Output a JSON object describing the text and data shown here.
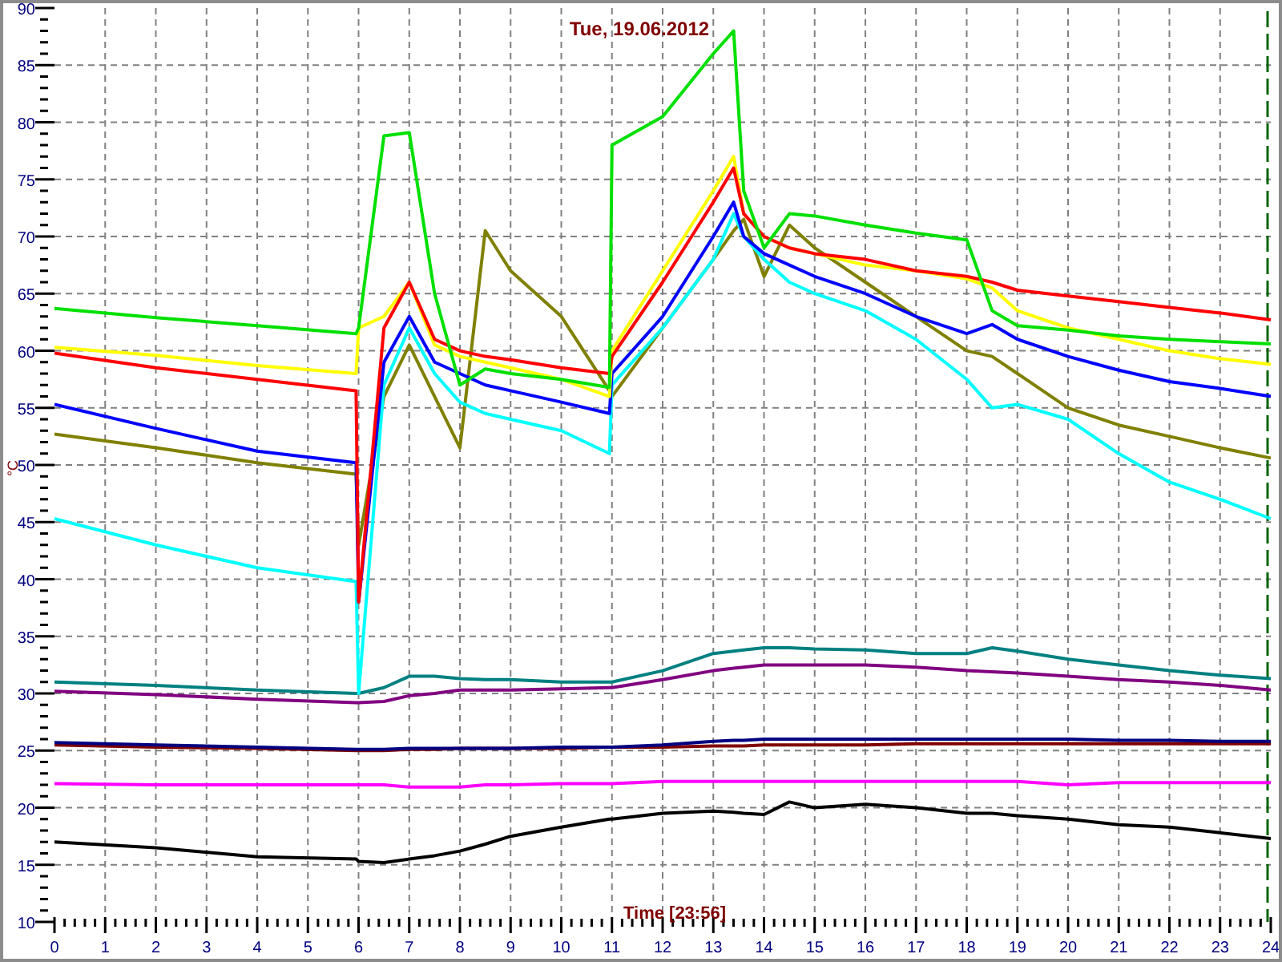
{
  "chart": {
    "chart_data": {
      "type": "line",
      "title": "Tue, 19.06.2012",
      "xlabel": "Time [23:56]",
      "ylabel": "°C",
      "x": [
        0,
        2,
        4,
        5.95,
        6,
        6.5,
        7,
        7.5,
        8,
        8.5,
        9,
        10,
        10.95,
        11,
        12,
        13,
        13.4,
        13.6,
        14,
        14.5,
        15,
        16,
        17,
        18,
        18.5,
        19,
        20,
        21,
        22,
        23,
        24
      ],
      "xlim": [
        0,
        24
      ],
      "ylim": [
        10,
        90
      ],
      "xticks": [
        0,
        1,
        2,
        3,
        4,
        5,
        6,
        7,
        8,
        9,
        10,
        11,
        12,
        13,
        14,
        15,
        16,
        17,
        18,
        19,
        20,
        21,
        22,
        23,
        24
      ],
      "yticks": [
        10,
        15,
        20,
        25,
        30,
        35,
        40,
        45,
        50,
        55,
        60,
        65,
        70,
        75,
        80,
        85,
        90
      ],
      "series": [
        {
          "color": "#800000",
          "values": [
            25.5,
            25.3,
            25.2,
            25,
            25,
            25,
            25.1,
            25.1,
            25.2,
            25.2,
            25.2,
            25.2,
            25.3,
            25.3,
            25.3,
            25.4,
            25.4,
            25.4,
            25.5,
            25.5,
            25.5,
            25.5,
            25.6,
            25.6,
            25.6,
            25.6,
            25.6,
            25.6,
            25.6,
            25.6,
            25.6
          ]
        },
        {
          "color": "#000080",
          "values": [
            25.7,
            25.5,
            25.3,
            25.1,
            25.1,
            25.1,
            25.2,
            25.2,
            25.2,
            25.2,
            25.2,
            25.3,
            25.3,
            25.3,
            25.5,
            25.8,
            25.9,
            25.9,
            26,
            26,
            26,
            26,
            26,
            26,
            26,
            26,
            26,
            25.9,
            25.9,
            25.8,
            25.8
          ]
        },
        {
          "color": "#ff00ff",
          "values": [
            22.1,
            22,
            22,
            22,
            22,
            22,
            21.8,
            21.8,
            21.8,
            22,
            22,
            22.1,
            22.1,
            22.1,
            22.3,
            22.3,
            22.3,
            22.3,
            22.3,
            22.3,
            22.3,
            22.3,
            22.3,
            22.3,
            22.3,
            22.3,
            22,
            22.2,
            22.2,
            22.2,
            22.2
          ]
        },
        {
          "color": "#000000",
          "values": [
            17,
            16.5,
            15.7,
            15.5,
            15.3,
            15.2,
            15.5,
            15.8,
            16.2,
            16.8,
            17.5,
            18.3,
            19,
            19,
            19.5,
            19.7,
            19.6,
            19.5,
            19.4,
            20.5,
            20,
            20.3,
            20,
            19.5,
            19.5,
            19.3,
            19,
            18.5,
            18.3,
            17.8,
            17.3
          ]
        },
        {
          "color": "#800080",
          "values": [
            30.2,
            29.9,
            29.5,
            29.2,
            29.2,
            29.3,
            29.8,
            30,
            30.3,
            30.3,
            30.3,
            30.4,
            30.5,
            30.5,
            31.2,
            32,
            32.2,
            32.3,
            32.5,
            32.5,
            32.5,
            32.5,
            32.3,
            32,
            31.9,
            31.8,
            31.5,
            31.2,
            31,
            30.7,
            30.3
          ]
        },
        {
          "color": "#008080",
          "values": [
            31,
            30.7,
            30.3,
            30,
            30,
            30.5,
            31.5,
            31.5,
            31.3,
            31.2,
            31.2,
            31,
            31,
            31,
            32,
            33.5,
            33.7,
            33.8,
            34,
            34,
            33.9,
            33.8,
            33.5,
            33.5,
            34,
            33.7,
            33,
            32.5,
            32,
            31.6,
            31.3
          ]
        },
        {
          "color": "#808000",
          "values": [
            52.7,
            51.5,
            50.2,
            49.2,
            43,
            56,
            60.5,
            56,
            51.5,
            70.5,
            67,
            63,
            56.5,
            56,
            62,
            68,
            70.5,
            71.5,
            66.5,
            71,
            69,
            66,
            63,
            60,
            59.5,
            58,
            55,
            53.5,
            52.5,
            51.5,
            50.6
          ]
        },
        {
          "color": "#00ffff",
          "values": [
            45.3,
            43,
            41,
            39.8,
            30,
            57,
            62,
            58,
            55.5,
            54.5,
            54,
            53,
            51,
            57,
            62,
            68,
            72,
            70,
            68,
            66,
            65,
            63.5,
            61,
            57.5,
            55,
            55.3,
            54,
            51,
            48.5,
            47,
            45.3
          ]
        },
        {
          "color": "#0000ff",
          "values": [
            55.3,
            53.2,
            51.2,
            50.2,
            38,
            59,
            63,
            59,
            58,
            57,
            56.5,
            55.5,
            54.5,
            58,
            63,
            70,
            73,
            70,
            68.5,
            67.5,
            66.5,
            65,
            63,
            61.5,
            62.3,
            61,
            59.5,
            58.3,
            57.3,
            56.7,
            56
          ]
        },
        {
          "color": "#ffff00",
          "values": [
            60.3,
            59.6,
            58.7,
            58,
            62,
            63,
            66,
            60.5,
            59.5,
            59,
            58.5,
            57.5,
            56,
            60,
            67,
            74,
            77,
            72,
            70,
            69,
            68.5,
            67.5,
            67,
            66.3,
            65.5,
            63.5,
            62,
            61,
            60,
            59.3,
            58.8
          ]
        },
        {
          "color": "#ff0000",
          "values": [
            59.8,
            58.5,
            57.5,
            56.5,
            38,
            62,
            66,
            61,
            60,
            59.5,
            59.2,
            58.5,
            58,
            59.5,
            66,
            73,
            76,
            72,
            70,
            69,
            68.5,
            68,
            67,
            66.5,
            66,
            65.3,
            64.8,
            64.3,
            63.8,
            63.3,
            62.7
          ]
        },
        {
          "color": "#00e000",
          "values": [
            63.7,
            62.9,
            62.2,
            61.5,
            62,
            78.8,
            79.1,
            65,
            57,
            58.4,
            58,
            57.5,
            56.8,
            78,
            80.5,
            86,
            88,
            74,
            69,
            72,
            71.8,
            71,
            70.3,
            69.7,
            63.5,
            62.2,
            61.8,
            61.3,
            61,
            60.8,
            60.6
          ]
        }
      ],
      "grid": true
    }
  }
}
